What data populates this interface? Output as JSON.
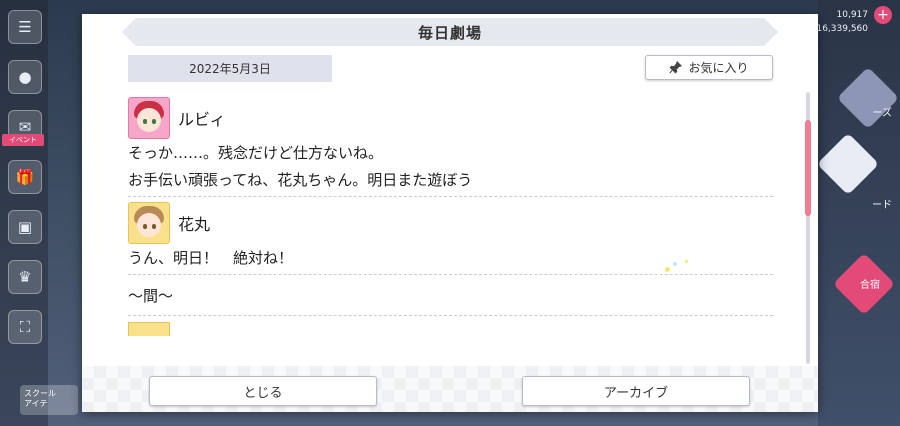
{
  "dialog": {
    "title": "毎日劇場",
    "date": "2022年5月3日",
    "favorite_label": "お気に入り"
  },
  "entries": [
    {
      "speaker": "ルビィ",
      "avatar": "ruby-avatar",
      "lines": [
        "そっか……。残念だけど仕方ないね。",
        "お手伝い頑張ってね、花丸ちゃん。明日また遊ぼう"
      ]
    },
    {
      "speaker": "花丸",
      "avatar": "hanamaru-avatar",
      "lines": [
        "うん、明日！　絶対ね！"
      ]
    }
  ],
  "interlude": "〜間〜",
  "buttons": {
    "close_label": "とじる",
    "archive_label": "アーカイブ"
  },
  "background": {
    "top_stat_1": "10,917",
    "top_stat_2": "16,339,560",
    "right_label_1": "ーズ",
    "right_label_2": "ード",
    "right_label_3": "合宿",
    "event_tag": "イベント",
    "bottom_left_text_1": "スクール",
    "bottom_left_text_2": "アイテ"
  },
  "colors": {
    "accent_pink": "#f07d92",
    "title_bar": "#e6e8f0",
    "date_box": "#dfe2ec"
  }
}
